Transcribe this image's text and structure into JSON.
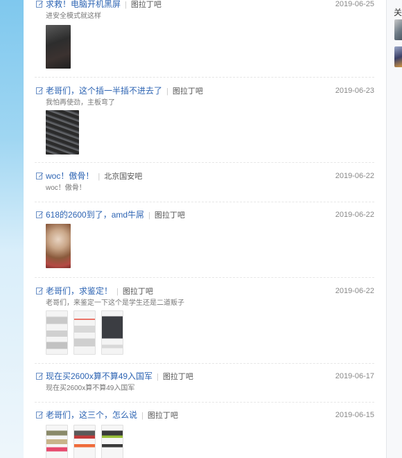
{
  "feed": {
    "posts": [
      {
        "title": "求救！电脑开机黑屏",
        "forum": "图拉丁吧",
        "date": "2019-06-25",
        "excerpt": "进安全模式就这样",
        "images": [
          "dark-monitor-photo"
        ]
      },
      {
        "title": "老哥们，这个插一半插不进去了",
        "forum": "图拉丁吧",
        "date": "2019-06-23",
        "excerpt": "我怕再使劲，主板弯了",
        "images": [
          "ram-slot-photo"
        ]
      },
      {
        "title": "woc！傲骨！",
        "forum": "北京国安吧",
        "date": "2019-06-22",
        "excerpt": "woc！傲骨！",
        "images": []
      },
      {
        "title": "618的2600到了，amd牛屌",
        "forum": "图拉丁吧",
        "date": "2019-06-22",
        "excerpt": "",
        "images": [
          "cpu-box-photo"
        ]
      },
      {
        "title": "老哥们，求鉴定！",
        "forum": "图拉丁吧",
        "date": "2019-06-22",
        "excerpt": "老哥们，来鉴定一下这个是学生还是二道贩子",
        "images": [
          "listing-screenshot-1",
          "listing-screenshot-2",
          "listing-screenshot-3"
        ]
      },
      {
        "title": "现在买2600x算不算49入国军",
        "forum": "图拉丁吧",
        "date": "2019-06-17",
        "excerpt": "现在买2600x算不算49入国军",
        "images": []
      },
      {
        "title": "老哥们，这三个，怎么说",
        "forum": "图拉丁吧",
        "date": "2019-06-15",
        "excerpt": "",
        "images": [
          "ram-listing-1",
          "ram-listing-2",
          "ram-listing-3"
        ]
      }
    ]
  },
  "right_panel": {
    "title": "关注"
  },
  "colors": {
    "title_link": "#2d64b3",
    "date_text": "#888888",
    "gutter_top": "#7fc8ee"
  }
}
